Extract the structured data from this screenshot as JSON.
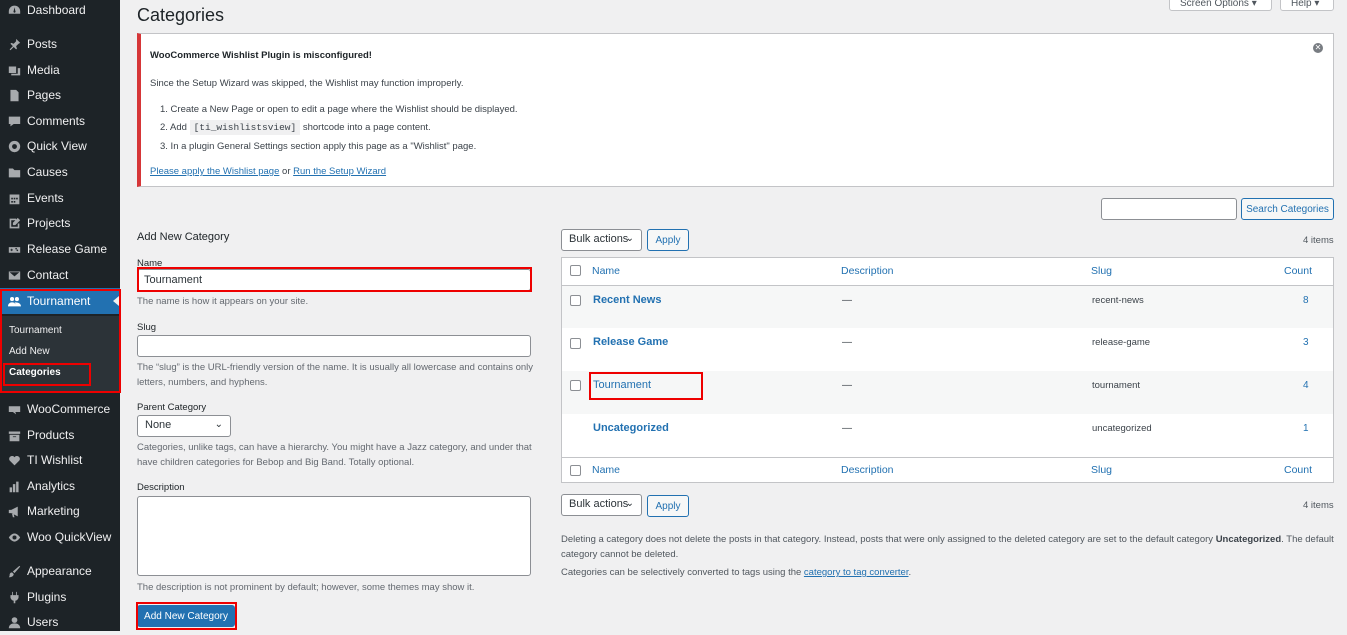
{
  "menu": {
    "items": [
      {
        "label": "Dashboard",
        "icon": "dashboard-icon"
      },
      {
        "label": "Posts",
        "icon": "pin-icon"
      },
      {
        "label": "Media",
        "icon": "media-icon"
      },
      {
        "label": "Pages",
        "icon": "page-icon"
      },
      {
        "label": "Comments",
        "icon": "comment-icon"
      },
      {
        "label": "Quick View",
        "icon": "circle-icon"
      },
      {
        "label": "Causes",
        "icon": "folder-icon"
      },
      {
        "label": "Events",
        "icon": "calendar-icon"
      },
      {
        "label": "Projects",
        "icon": "edit-icon"
      },
      {
        "label": "Release Game",
        "icon": "gamepad-icon"
      },
      {
        "label": "Contact",
        "icon": "envelope-icon"
      },
      {
        "label": "Tournament",
        "icon": "users-icon"
      },
      {
        "label": "WooCommerce",
        "icon": "woo-icon"
      },
      {
        "label": "Products",
        "icon": "box-icon"
      },
      {
        "label": "TI Wishlist",
        "icon": "heart-icon"
      },
      {
        "label": "Analytics",
        "icon": "bar-chart-icon"
      },
      {
        "label": "Marketing",
        "icon": "megaphone-icon"
      },
      {
        "label": "Woo QuickView",
        "icon": "eye-icon"
      },
      {
        "label": "Appearance",
        "icon": "brush-icon"
      },
      {
        "label": "Plugins",
        "icon": "plug-icon"
      },
      {
        "label": "Users",
        "icon": "user-icon"
      }
    ],
    "submenu": [
      "Tournament",
      "Add New",
      "Categories"
    ]
  },
  "header": {
    "title": "Categories",
    "screen_options": "Screen Options ▾",
    "help": "Help ▾"
  },
  "notice": {
    "title": "WooCommerce Wishlist Plugin is misconfigured!",
    "line1": "Since the Setup Wizard was skipped, the Wishlist may function improperly.",
    "step1": "1. Create a New Page or open to edit a page where the Wishlist should be displayed.",
    "step2_a": "2. Add",
    "step2_code": "[ti_wishlistsview]",
    "step2_b": "shortcode into a page content.",
    "step3": "3. In a plugin General Settings section apply this page as a \"Wishlist\" page.",
    "link1": "Please apply the Wishlist page",
    "or": "or",
    "link2": "Run the Setup Wizard",
    "dismiss_glyph": "✕"
  },
  "form": {
    "heading": "Add New Category",
    "name_label": "Name",
    "name_value": "Tournament",
    "name_help": "The name is how it appears on your site.",
    "slug_label": "Slug",
    "slug_value": "",
    "slug_help": "The “slug” is the URL-friendly version of the name. It is usually all lowercase and contains only letters, numbers, and hyphens.",
    "parent_label": "Parent Category",
    "parent_value": "None",
    "parent_help": "Categories, unlike tags, can have a hierarchy. You might have a Jazz category, and under that have children categories for Bebop and Big Band. Totally optional.",
    "desc_label": "Description",
    "desc_value": "",
    "desc_help": "The description is not prominent by default; however, some themes may show it.",
    "submit": "Add New Category"
  },
  "list": {
    "search_button": "Search Categories",
    "search_value": "",
    "bulk_actions": "Bulk actions",
    "apply": "Apply",
    "items_count": "4 items",
    "columns": {
      "name": "Name",
      "description": "Description",
      "slug": "Slug",
      "count": "Count"
    },
    "rows": [
      {
        "name": "Recent News",
        "description": "—",
        "slug": "recent-news",
        "count": "8"
      },
      {
        "name": "Release Game",
        "description": "—",
        "slug": "release-game",
        "count": "3"
      },
      {
        "name": "Tournament",
        "description": "—",
        "slug": "tournament",
        "count": "4"
      },
      {
        "name": "Uncategorized",
        "description": "—",
        "slug": "uncategorized",
        "count": "1"
      }
    ],
    "note1_a": "Deleting a category does not delete the posts in that category. Instead, posts that were only assigned to the deleted category are set to the default category",
    "note1_bold": "Uncategorized",
    "note1_b": ". The default category cannot be deleted.",
    "note2_a": "Categories can be selectively converted to tags using the",
    "note2_link": "category to tag converter",
    "note2_b": "."
  },
  "colors": {
    "accent": "#2271b1",
    "menu_bg": "#1d2327",
    "highlight": "#e00000",
    "notice_error": "#d63638"
  }
}
